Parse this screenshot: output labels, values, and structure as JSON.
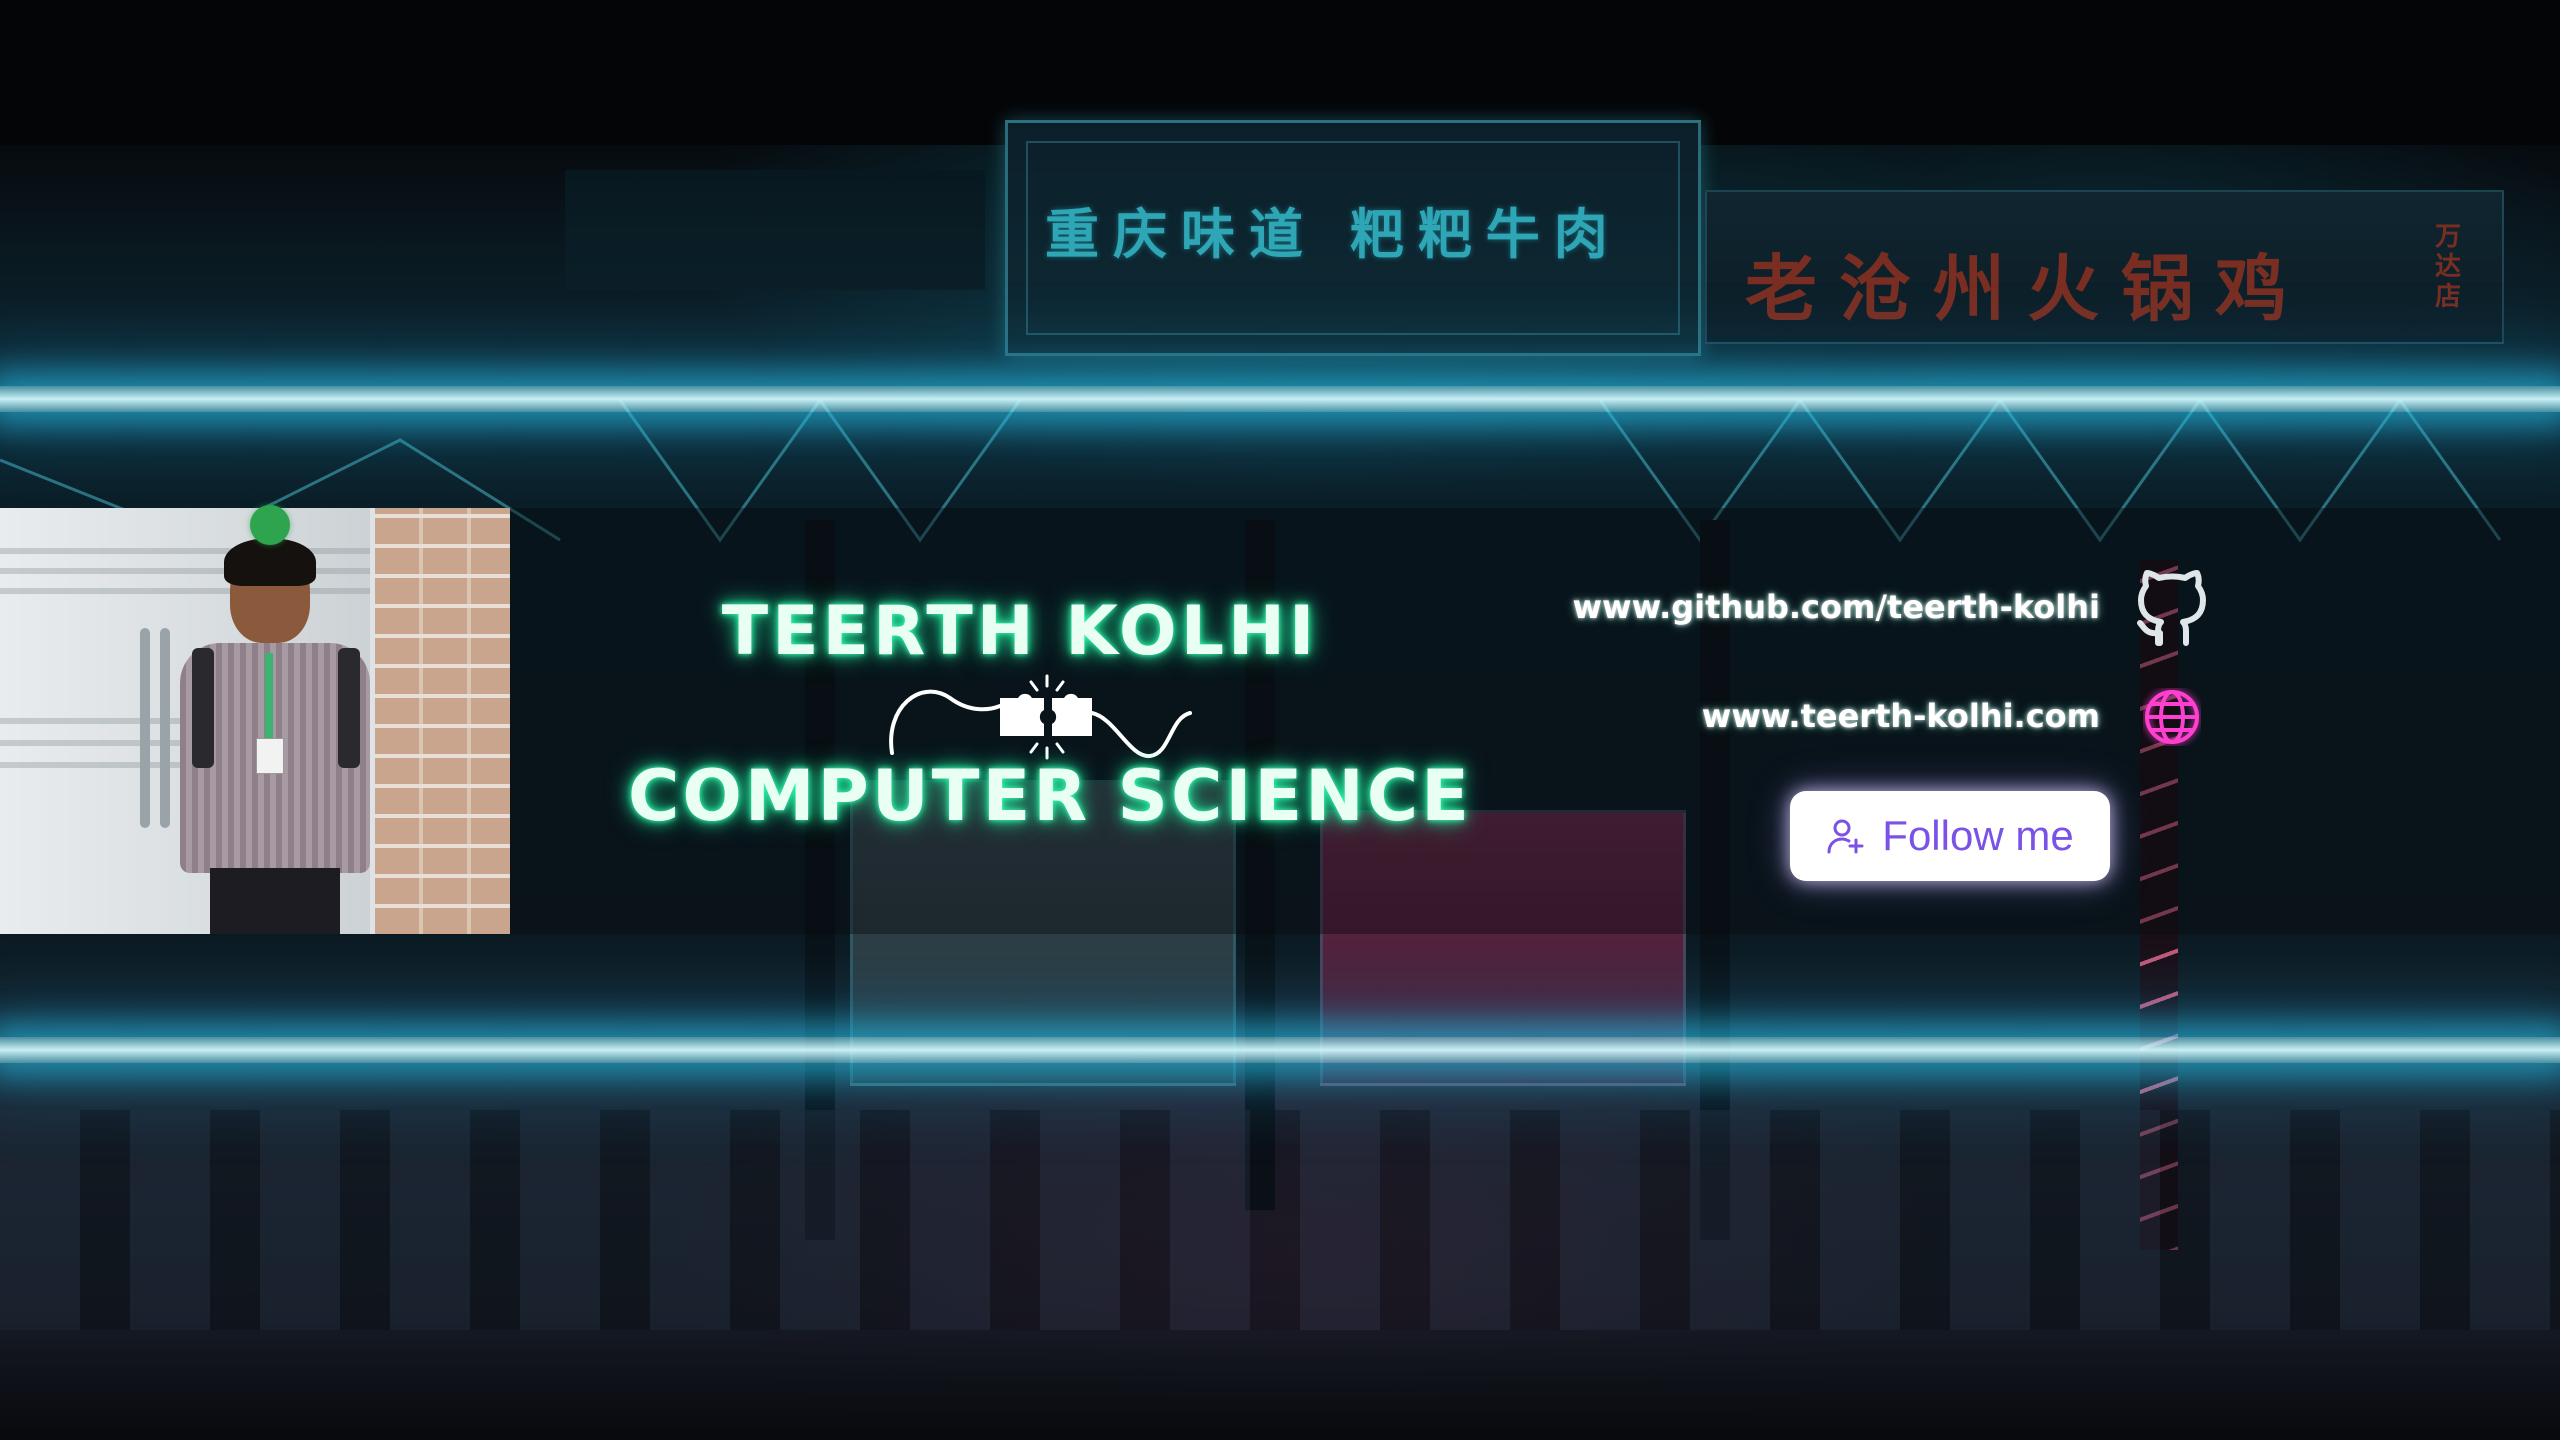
{
  "banner": {
    "name": "TEERTH KOLHI",
    "field": "COMPUTER SCIENCE"
  },
  "links": {
    "github": "www.github.com/teerth-kolhi",
    "website": "www.teerth-kolhi.com"
  },
  "follow_button": {
    "label": "Follow me"
  },
  "background_signs": {
    "center": "重庆味道  粑粑牛肉",
    "right": "老沧州火锅鸡",
    "right_sub": "万达店"
  },
  "colors": {
    "neon_text_glow": "#1fe39a",
    "neon_bar": "#28c8f0",
    "button_text": "#7b52e6",
    "globe_icon": "#ff3fd0"
  },
  "icons": {
    "github": "github-icon",
    "website": "globe-icon",
    "follow": "user-plus-icon",
    "divider": "plug-icon"
  }
}
